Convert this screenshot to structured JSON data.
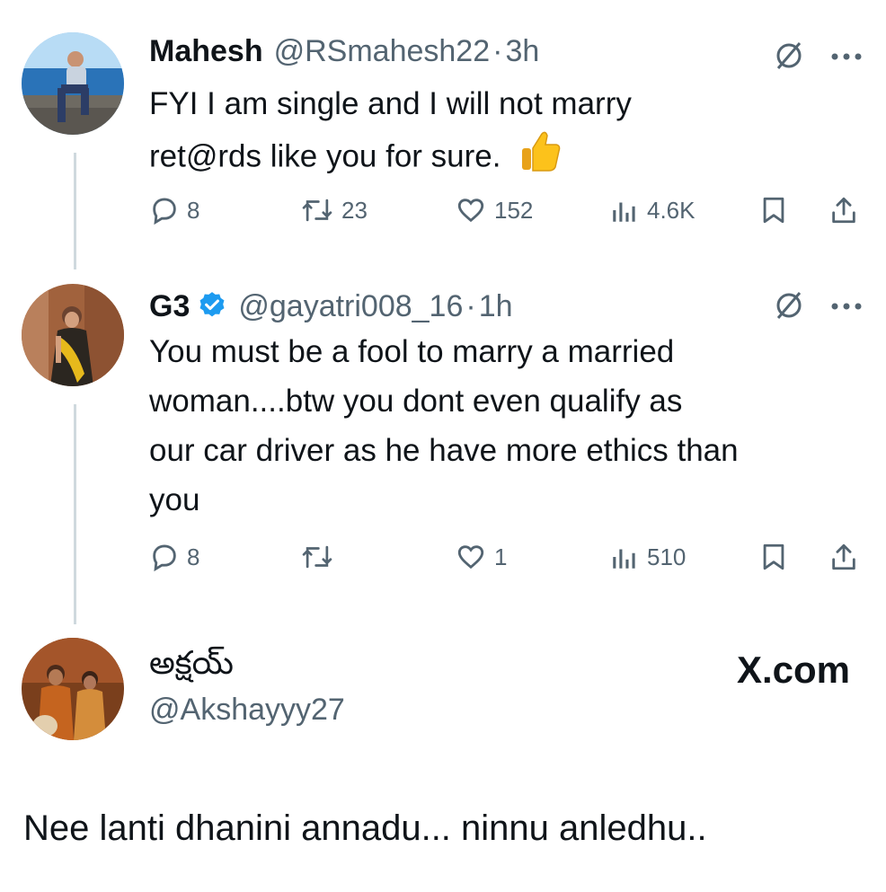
{
  "tweets": [
    {
      "name": "Mahesh",
      "handle": "@RSmahesh22",
      "separator": "·",
      "time": "3h",
      "text_lines": [
        "FYI I am single and I will not marry",
        "ret@rds like you for sure."
      ],
      "emoji": "👍",
      "replies": "8",
      "retweets": "23",
      "likes": "152",
      "views": "4.6K"
    },
    {
      "name": "G3",
      "handle": "@gayatri008_16",
      "separator": "·",
      "time": "1h",
      "verified": true,
      "text_lines": [
        "You must be a fool to marry a married",
        "woman....btw you dont even qualify as",
        "our car driver as he have more ethics than",
        "you"
      ],
      "replies": "8",
      "retweets": "",
      "likes": "1",
      "views": "510"
    }
  ],
  "quote_author": {
    "name": "అక్షయ్",
    "handle": "@Akshayyy27"
  },
  "watermark": "X.com",
  "caption": "Nee lanti dhanini annadu... ninnu anledhu..",
  "colors": {
    "text": "#0f1419",
    "muted": "#536471",
    "thread_line": "#cfd9de",
    "verified": "#1d9bf0"
  },
  "icons": [
    "grok-icon",
    "more-icon",
    "reply-icon",
    "retweet-icon",
    "like-icon",
    "views-icon",
    "bookmark-icon",
    "share-icon",
    "verified-badge-icon",
    "thumbs-up-emoji"
  ]
}
